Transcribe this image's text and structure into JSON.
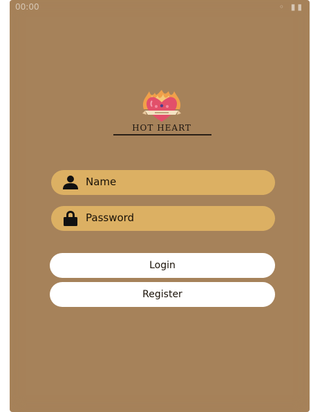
{
  "status_bar": {
    "time": "00:00",
    "icons": "◦ ▮▮"
  },
  "brand": {
    "name": "HOT HEART"
  },
  "form": {
    "name_placeholder": "Name",
    "password_placeholder": "Password"
  },
  "buttons": {
    "login": "Login",
    "register": "Register"
  },
  "icons": {
    "name": "user-icon",
    "password": "lock-icon",
    "logo": "flaming-heart-logo-icon"
  },
  "colors": {
    "background": "#a6825a",
    "input_fill": "#dcb063",
    "button_fill": "#ffffff",
    "text": "#1a1208"
  }
}
